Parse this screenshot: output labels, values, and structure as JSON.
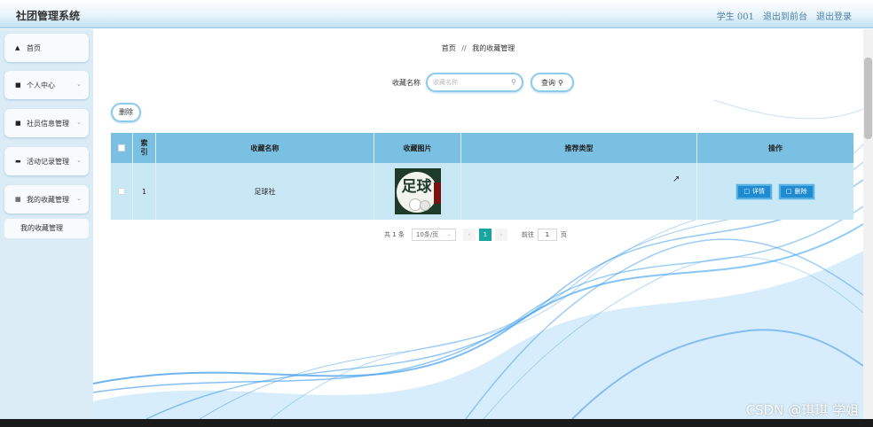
{
  "header": {
    "title": "社团管理系统",
    "user": "学生 001",
    "back_label": "退出到前台",
    "logout_label": "退出登录"
  },
  "sidebar": {
    "items": [
      {
        "label": "首页",
        "icon": "home-icon",
        "has_chevron": false
      },
      {
        "label": "个人中心",
        "icon": "user-icon",
        "has_chevron": true
      },
      {
        "label": "社员信息管理",
        "icon": "user-icon",
        "has_chevron": true
      },
      {
        "label": "活动记录管理",
        "icon": "list-icon",
        "has_chevron": true
      },
      {
        "label": "我的收藏管理",
        "icon": "grid-icon",
        "has_chevron": true
      }
    ],
    "sub_item": "我的收藏管理"
  },
  "breadcrumb": {
    "home": "首页",
    "separator": "//",
    "current": "我的收藏管理"
  },
  "search": {
    "label": "收藏名称",
    "placeholder": "收藏名称",
    "query_label": "查询"
  },
  "toolbar": {
    "delete_label": "删除"
  },
  "table": {
    "headers": [
      "",
      "索引",
      "收藏名称",
      "收藏图片",
      "推荐类型",
      "操作"
    ],
    "rows": [
      {
        "index": "1",
        "name": "足球社",
        "image_title": "足球",
        "type": "",
        "detail_label": "详情",
        "delete_label": "删除"
      }
    ]
  },
  "pagination": {
    "total_text": "共 1 条",
    "page_size": "10条/页",
    "current_page": "1",
    "goto_label": "前往",
    "goto_value": "1",
    "page_word": "页"
  },
  "watermark": "CSDN @琪琪 学姐",
  "colors": {
    "header_bottom": "#bfe0f2",
    "sidebar_bg": "#dcecf6",
    "table_header": "#79c0e2",
    "table_row": "#c9e8f6",
    "action_button": "#1f8bd1",
    "pager_active": "#18a5a0"
  }
}
